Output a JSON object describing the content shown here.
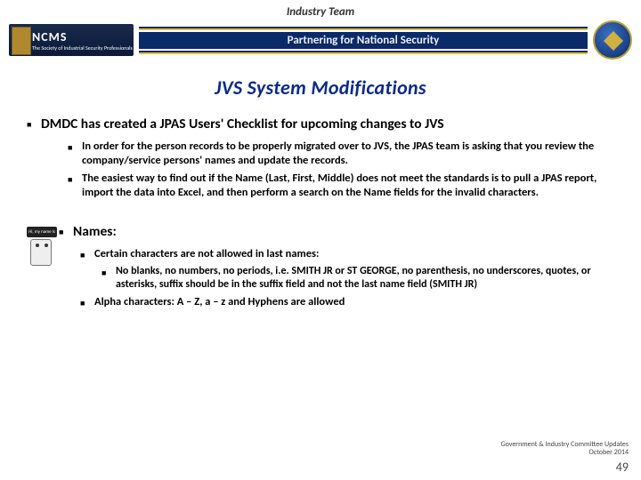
{
  "header": {
    "industry_team": "Industry Team",
    "logo_big": "NCMS",
    "logo_small": "The Society of Industrial Security Professionals",
    "banner_text": "Partnering for National Security"
  },
  "title": "JVS System Modifications",
  "bullet1": {
    "text": "DMDC has created a JPAS Users' Checklist for upcoming changes to JVS",
    "sub": [
      "In order for the person records to be properly migrated over to JVS, the JPAS team is asking that you review the company/service persons' names and update the records.",
      "The easiest way to find out if the Name (Last, First, Middle) does not meet the standards is to pull a JPAS report, import the data into Excel, and then perform a search on the Name fields for the invalid characters."
    ]
  },
  "bullet2": {
    "text": "Names:",
    "mascot_label": "Hi, my name is",
    "sub": [
      "Certain  characters are not allowed in last names:"
    ],
    "subsub": [
      "No blanks, no numbers, no periods, i.e. SMITH JR or ST GEORGE, no  parenthesis, no underscores, quotes, or asterisks, suffix should be in the suffix field and not the last name field (SMITH JR)"
    ],
    "sub_after": [
      " Alpha characters: A – Z, a – z and  Hyphens are allowed"
    ]
  },
  "footer": {
    "line1": "Government & Industry Committee Updates",
    "line2": "October 2014",
    "page": "49"
  }
}
